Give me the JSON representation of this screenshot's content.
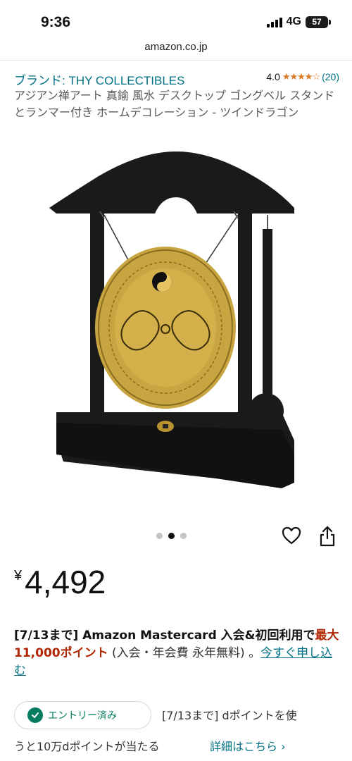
{
  "status_bar": {
    "time": "9:36",
    "network": "4G",
    "battery": "57"
  },
  "browser": {
    "url": "amazon.co.jp"
  },
  "product": {
    "brand_link": "ブランド: THY COLLECTIBLES",
    "rating_value": "4.0",
    "rating_stars": "★★★★☆",
    "rating_count": "(20)",
    "title": "アジアン禅アート 真鍮 風水 デスクトップ ゴングベル スタンドとランマー付き ホームデコレーション - ツインドラゴン"
  },
  "carousel": {
    "dots": 3,
    "active_index": 1
  },
  "price": {
    "symbol": "¥",
    "value": "4,492"
  },
  "promo": {
    "prefix": "[7/13まで] Amazon Mastercard 入会&初回利用で",
    "highlight": "最大11,000ポイント",
    "suffix": " (入会・年会費 永年無料) 。",
    "link": "今すぐ申し込む"
  },
  "entry": {
    "badge": "エントリー済み",
    "line1": "[7/13まで] dポイントを使",
    "line2": "うと10万dポイントが当たる",
    "link": "詳細はこちら ›"
  },
  "colors": {
    "link": "#007185",
    "star": "#de7921",
    "promo_red": "#b12704",
    "entry_green": "#067d62",
    "brass": "#c8a540",
    "wood": "#1a1a1a"
  }
}
